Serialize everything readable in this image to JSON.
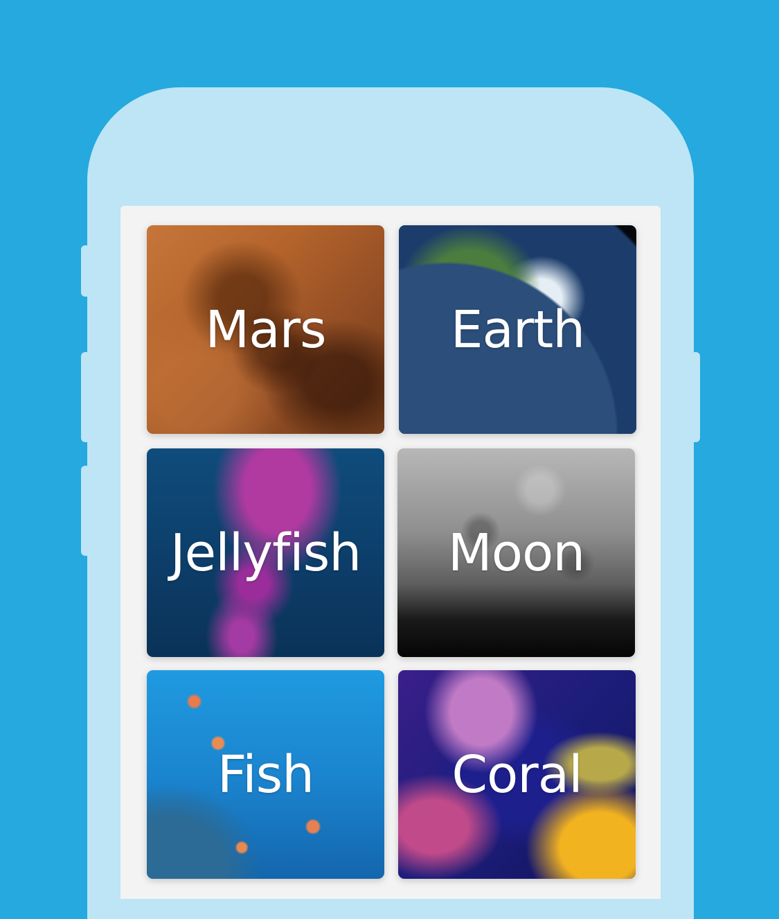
{
  "background_color": "#25a9de",
  "phone_color": "#bde5f6",
  "tiles": [
    {
      "label": "Mars",
      "art": "mars-surface-image"
    },
    {
      "label": "Earth",
      "art": "earth-from-space-image"
    },
    {
      "label": "Jellyfish",
      "art": "jellyfish-image"
    },
    {
      "label": "Moon",
      "art": "moon-surface-image"
    },
    {
      "label": "Fish",
      "art": "fish-underwater-image"
    },
    {
      "label": "Coral",
      "art": "coral-reef-image"
    }
  ]
}
